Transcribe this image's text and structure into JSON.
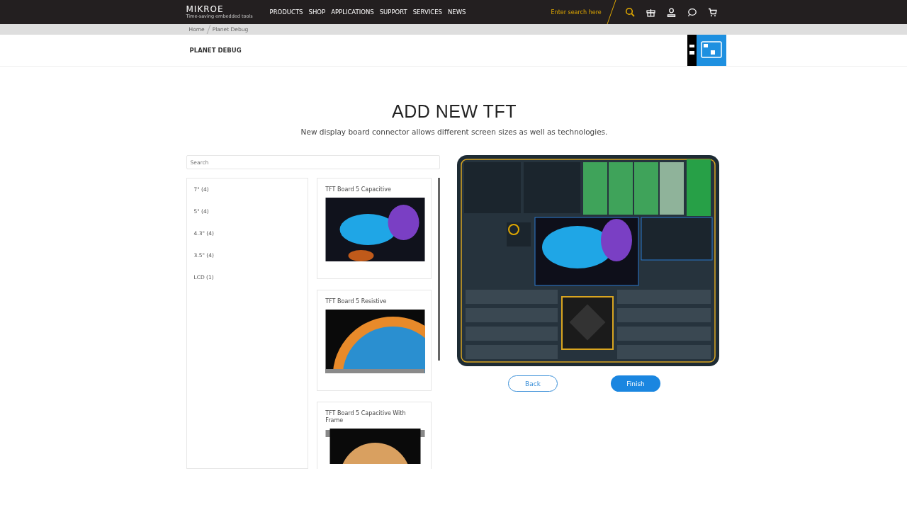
{
  "header": {
    "logo": "MIKROE",
    "tagline": "Time-saving embedded tools",
    "nav": [
      "PRODUCTS",
      "SHOP",
      "APPLICATIONS",
      "SUPPORT",
      "SERVICES",
      "NEWS"
    ],
    "search": {
      "placeholder": "Enter search here"
    }
  },
  "breadcrumb": [
    "Home",
    "Planet Debug"
  ],
  "subheader": {
    "title": "PLANET DEBUG"
  },
  "main": {
    "title": "ADD NEW TFT",
    "subtitle": "New display board connector allows different screen sizes as well as technologies."
  },
  "search": {
    "placeholder": "Search"
  },
  "filters": [
    "7\" (4)",
    "5\" (4)",
    "4.3\" (4)",
    "3.5\" (4)",
    "LCD (1)"
  ],
  "products": [
    {
      "name": "TFT Board 5 Capacitive",
      "kind": "jellyfish"
    },
    {
      "name": "TFT Board 5 Resistive",
      "kind": "planet"
    },
    {
      "name": "TFT Board 5 Capacitive With Frame",
      "kind": "framed"
    }
  ],
  "buttons": {
    "back": "Back",
    "finish": "Finish"
  }
}
